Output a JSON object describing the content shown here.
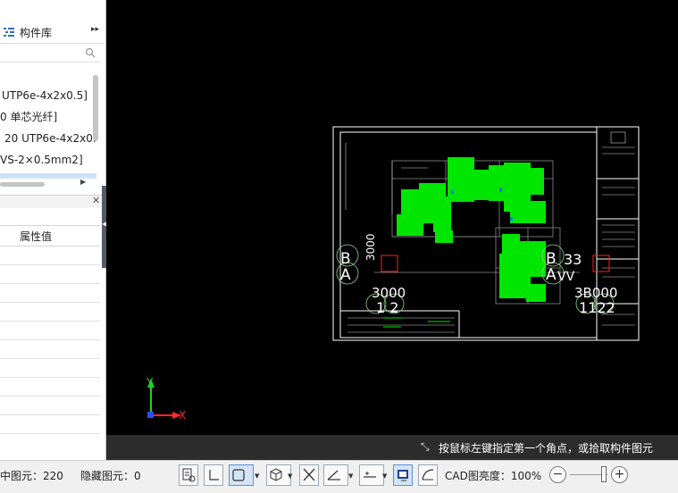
{
  "library": {
    "tab_label": "构件库",
    "items": [
      {
        "label": "UTP6e-4x2x0.5]",
        "selected": false
      },
      {
        "label": "0 单芯光纤]",
        "selected": false
      },
      {
        "label": "20 UTP6e-4x2x0.",
        "selected": false
      },
      {
        "label": "VS-2×0.5mm2]",
        "selected": false
      },
      {
        "label": "",
        "selected": true
      }
    ]
  },
  "properties": {
    "column_value": "属性值"
  },
  "canvas": {
    "background": "#000000",
    "axis": {
      "x_label": "X",
      "y_label": "Y",
      "x_color": "#ff2a2a",
      "y_color": "#21d321"
    },
    "drawing_labels": [
      {
        "text": "B"
      },
      {
        "text": "A"
      },
      {
        "text": "3000"
      },
      {
        "text": "3000"
      },
      {
        "text": "1 2"
      },
      {
        "text": "B"
      },
      {
        "text": "A"
      },
      {
        "text": "33"
      },
      {
        "text": "VV"
      },
      {
        "text": "3B000"
      },
      {
        "text": "1122"
      }
    ],
    "prompt": "按鼠标左键指定第一个角点，或拾取构件图元"
  },
  "status_bar": {
    "selected_count_label": "中图元：220",
    "hidden_count_label": "隐藏图元：0",
    "cad_brightness_label": "CAD图亮度：100%",
    "zoom_minus": "−",
    "zoom_plus": "+",
    "brightness_percent": 100
  },
  "colors": {
    "accent": "#5c8fd6",
    "element_green": "#00ff00",
    "prompt_bar": "#2c2c2c"
  }
}
